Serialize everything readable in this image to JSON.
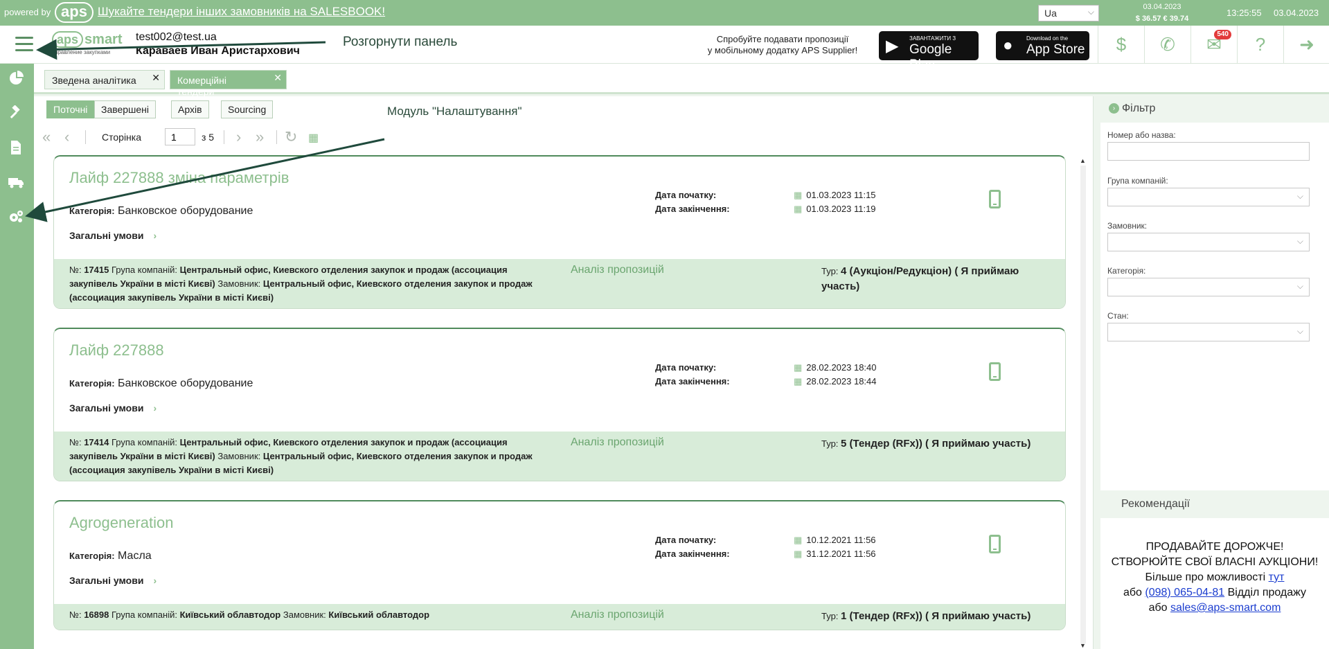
{
  "topbar": {
    "powered_by": "powered by",
    "logo_text": "aps",
    "promo_link": "Шукайте тендери інших замовників на SALESBOOK!",
    "language": "Ua",
    "rate_date": "03.04.2023",
    "rates": "$ 36.57  € 39.74",
    "time": "13:25:55",
    "date": "03.04.2023"
  },
  "header": {
    "logo_aps": "aps",
    "logo_smart": "smart",
    "logo_sub": "управление закупками",
    "user_email": "test002@test.ua",
    "user_name": "Караваев Иван Аристархович",
    "annotation_panel": "Розгорнути панель",
    "mobile_promo_line1": "Спробуйте подавати пропозиції",
    "mobile_promo_line2": "у мобільному додатку APS Supplier!",
    "google_play_small": "ЗАВАНТАЖИТИ З",
    "google_play_big": "Google Play",
    "app_store_small": "Download on the",
    "app_store_big": "App Store",
    "messages_badge": "540"
  },
  "tabs": [
    {
      "label": "Зведена аналітика"
    },
    {
      "label": "Комерційні тендери"
    }
  ],
  "subtabs": [
    {
      "label": "Поточні"
    },
    {
      "label": "Завершені"
    },
    {
      "label": "Архів"
    },
    {
      "label": "Sourcing"
    }
  ],
  "annotation_module": "Модуль \"Налаштування\"",
  "pager": {
    "label": "Сторінка",
    "page": "1",
    "of_label": "з 5"
  },
  "card_labels": {
    "category": "Категорія:",
    "conditions": "Загальні умови",
    "start": "Дата початку:",
    "end": "Дата закінчення:",
    "number": "№:",
    "group": "Група компаній:",
    "customer": "Замовник:",
    "analysis": "Аналіз пропозицій",
    "tour": "Тур:"
  },
  "tenders": [
    {
      "title": "Лайф 227888 зміна параметрів",
      "category": "Банковское оборудование",
      "start": "01.03.2023 11:15",
      "end": "01.03.2023 11:19",
      "number": "17415",
      "group": "Центральный офис, Киевского отделения закупок и продаж (ассоциация закупівель України в місті Києві)",
      "customer": "Центральный офис, Киевского отделения закупок и продаж (ассоциация закупівель України в місті Києві)",
      "tour": "4 (Аукціон/Редукціон) ( Я приймаю участь)"
    },
    {
      "title": "Лайф 227888",
      "category": "Банковское оборудование",
      "start": "28.02.2023 18:40",
      "end": "28.02.2023 18:44",
      "number": "17414",
      "group": "Центральный офис, Киевского отделения закупок и продаж (ассоциация закупівель України в місті Києві)",
      "customer": "Центральный офис, Киевского отделения закупок и продаж (ассоциация закупівель України в місті Києві)",
      "tour": "5 (Тендер (RFx)) ( Я приймаю участь)"
    },
    {
      "title": "Agrogeneration",
      "category": "Масла",
      "start": "10.12.2021 11:56",
      "end": "31.12.2021 11:56",
      "number": "16898",
      "group": "Київський облавтодор",
      "customer": "Київський облавтодор",
      "tour": "1 (Тендер (RFx)) ( Я приймаю участь)"
    }
  ],
  "filter": {
    "title": "Фільтр",
    "fields": [
      {
        "label": "Номер або назва:"
      },
      {
        "label": "Група компаній:"
      },
      {
        "label": "Замовник:"
      },
      {
        "label": "Категорія:"
      },
      {
        "label": "Стан:"
      }
    ]
  },
  "recommendations": {
    "title": "Рекомендації",
    "line1": "ПРОДАВАЙТЕ ДОРОЖЧЕ!",
    "line2": "СТВОРЮЙТЕ СВОЇ ВЛАСНІ АУКЦІОНИ!",
    "line3_text": "Більше про можливості",
    "line3_link": "тут",
    "line4_pre": "або",
    "line4_phone": "(098) 065-04-81",
    "line4_post": "Відділ продажу",
    "line5_pre": "або",
    "line5_email": "sales@aps-smart.com"
  }
}
